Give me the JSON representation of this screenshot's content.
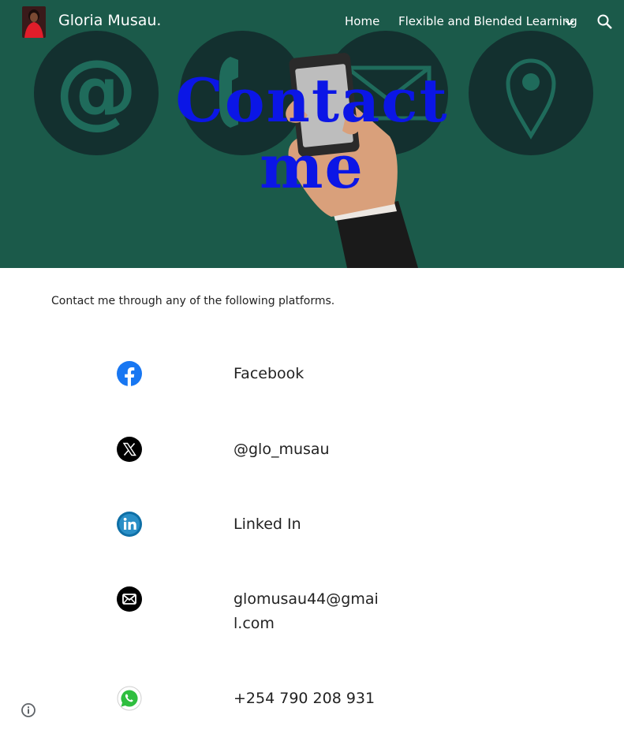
{
  "header": {
    "site_title": "Gloria Musau.",
    "nav": [
      {
        "label": "Home"
      },
      {
        "label": "Flexible and Blended Learning"
      }
    ],
    "icons": {
      "dropdown": "chevron-down-icon",
      "search": "search-icon"
    }
  },
  "hero": {
    "title_line1": "Contact",
    "title_line2": "me",
    "title_color": "#0b16e6",
    "background_color": "#1b5a4a",
    "icons": [
      "at-sign-icon",
      "phone-icon",
      "envelope-icon",
      "location-pin-icon"
    ]
  },
  "main": {
    "intro": "Contact me through any of the following platforms.",
    "contacts": [
      {
        "icon": "facebook-icon",
        "label": "Facebook"
      },
      {
        "icon": "x-twitter-icon",
        "label": "@glo_musau"
      },
      {
        "icon": "linkedin-icon",
        "label": "Linked In"
      },
      {
        "icon": "email-icon",
        "label": "glomusau44@gmail.com"
      },
      {
        "icon": "whatsapp-icon",
        "label": "+254 790 208 931"
      }
    ]
  },
  "footer": {
    "icon": "info-icon"
  }
}
